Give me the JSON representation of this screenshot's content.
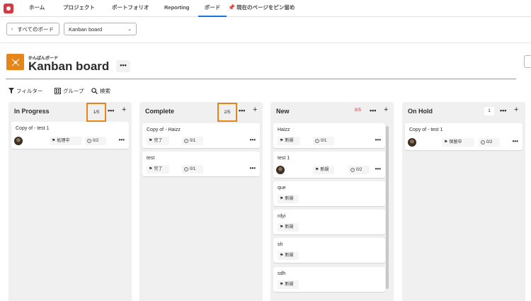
{
  "nav": {
    "items": [
      "ホーム",
      "プロジェクト",
      "ポートフォリオ",
      "Reporting",
      "ボード"
    ],
    "pin_label": "現在のページをピン留め"
  },
  "board_selector": {
    "back_label": "すべてのボード",
    "current_board": "Kanban board"
  },
  "header": {
    "kicker": "かんばんボード",
    "title": "Kanban board",
    "more": "•••"
  },
  "toolbar": {
    "filter": "フィルター",
    "group": "グループ",
    "search": "検索"
  },
  "columns": [
    {
      "title": "In Progress",
      "count": "1/5",
      "cards": [
        {
          "title": "Copy of - test 1",
          "status": "処理中",
          "checklist": "0/2",
          "has_avatar": true
        }
      ]
    },
    {
      "title": "Complete",
      "count": "2/5",
      "cards": [
        {
          "title": "Copy of - Haizz",
          "status": "完了",
          "checklist": "0/1",
          "has_avatar": false
        },
        {
          "title": "test",
          "status": "完了",
          "checklist": "0/1",
          "has_avatar": false
        }
      ]
    },
    {
      "title": "New",
      "count": "8/5",
      "count_color": "#d7373f",
      "cards": [
        {
          "title": "Haizz",
          "status": "新規",
          "checklist": "0/1",
          "has_avatar": false
        },
        {
          "title": "test 1",
          "status": "新規",
          "checklist": "0/2",
          "has_avatar": true
        },
        {
          "title": "que",
          "status": "新規",
          "has_avatar": false
        },
        {
          "title": "rdyi",
          "status": "新規",
          "has_avatar": false
        },
        {
          "title": "sh",
          "status": "新規",
          "has_avatar": false
        },
        {
          "title": "sdh",
          "status": "新規",
          "has_avatar": false
        }
      ]
    },
    {
      "title": "On Hold",
      "count": "1",
      "cards": [
        {
          "title": "Copy of - test 1",
          "status": "保留中",
          "checklist": "0/2",
          "has_avatar": true
        }
      ]
    }
  ],
  "colors": {
    "accent_orange": "#e68619",
    "over_limit_red": "#d7373f",
    "column_bg": "#f0f0f0"
  }
}
